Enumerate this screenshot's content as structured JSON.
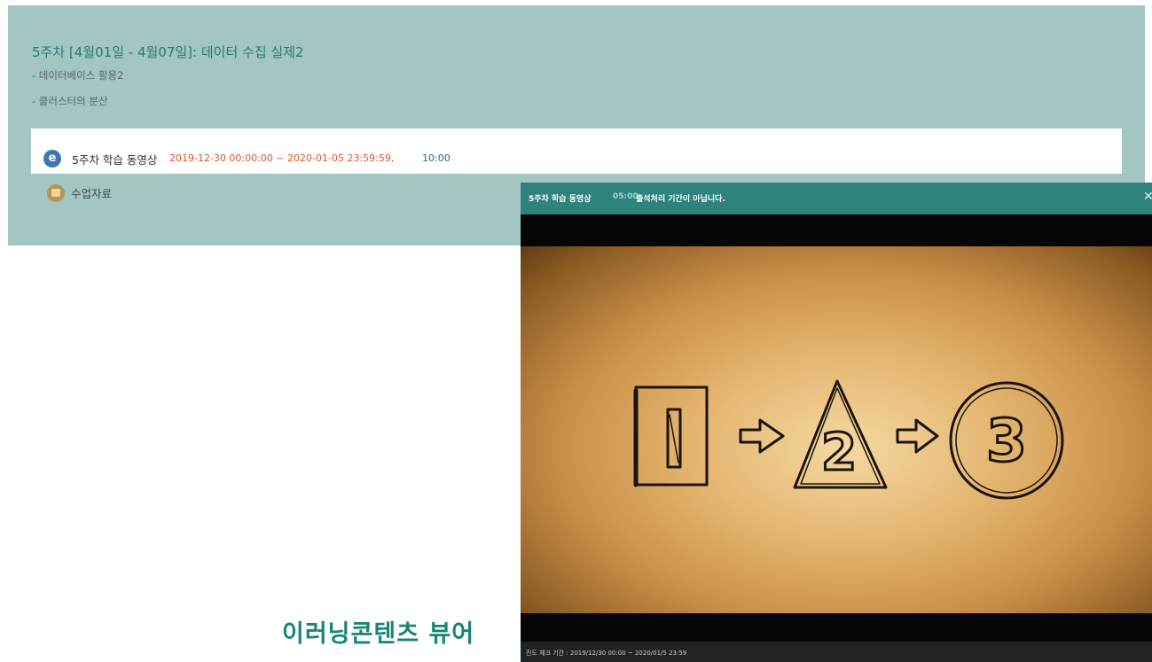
{
  "week": {
    "title": "5주차 [4월01일 - 4월07일]: 데이터 수집 실제2",
    "topics": [
      "- 데이터베이스 활용2",
      "- 클러스터의 분산"
    ],
    "activity": {
      "icon": "e",
      "name": "5주차 학습 동영상",
      "period": "2019-12-30 00:00:00 ~ 2020-01-05 23:59:59,",
      "duration": "10:00"
    },
    "resource": {
      "label": "수업자료"
    }
  },
  "viewer": {
    "title": "5주차 학습 동영상",
    "elapsed": "05:00",
    "notice": "출석처리 기간이 아닙니다.",
    "close": "✕",
    "footer": "진도 체크 기간 : 2019/12/30 00:00 ~ 2020/01/5 23:59",
    "video": {
      "steps": [
        "1",
        "2",
        "3"
      ]
    }
  },
  "caption": "이러닝콘텐츠 뷰어",
  "colors": {
    "panel_bg": "#a4c6c3",
    "accent": "#1f7d72",
    "period": "#d8572e",
    "viewer_header": "#2e837d"
  }
}
